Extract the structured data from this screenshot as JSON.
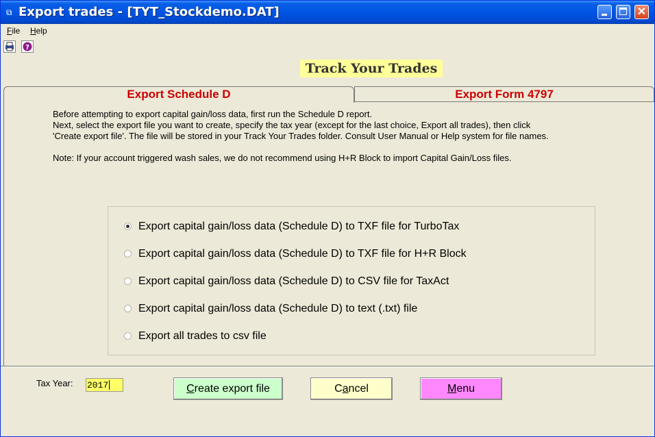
{
  "window": {
    "title": "Export trades - [TYT_Stockdemo.DAT]",
    "controls": {
      "minimize": "",
      "maximize": "",
      "close": "✕"
    }
  },
  "menubar": {
    "items": [
      {
        "mnemonic": "F",
        "rest": "ile"
      },
      {
        "mnemonic": "H",
        "rest": "elp"
      }
    ]
  },
  "toolbar": {
    "icons": [
      "print-icon",
      "help-icon"
    ]
  },
  "brand": {
    "text": "Track Your Trades"
  },
  "tabs": [
    {
      "label": "Export Schedule D",
      "active": true
    },
    {
      "label": "Export Form 4797",
      "active": false
    }
  ],
  "instructions": {
    "line1": "Before attempting to export capital gain/loss data, first run the Schedule D report.",
    "line2": "Next, select the export file you want to create, specify the tax year (except for the last choice, Export all trades), then click",
    "line3": "'Create export file'.  The file will be stored in your Track Your Trades folder.  Consult User Manual or Help system for file names.",
    "note": "Note: If your account triggered wash sales, we do not recommend using H+R Block to import Capital Gain/Loss files."
  },
  "options": [
    {
      "label": "Export capital gain/loss data (Schedule D) to TXF file for TurboTax",
      "selected": true
    },
    {
      "label": "Export capital gain/loss data (Schedule D) to TXF file for H+R Block",
      "selected": false
    },
    {
      "label": "Export capital gain/loss data (Schedule D) to CSV file for TaxAct",
      "selected": false
    },
    {
      "label": "Export capital gain/loss data (Schedule D) to text (.txt) file",
      "selected": false
    },
    {
      "label": "Export all trades to csv file",
      "selected": false
    }
  ],
  "tax_year": {
    "label": "Tax Year:",
    "value": "2017"
  },
  "buttons": {
    "create": {
      "mnemonic": "C",
      "rest": "reate export file",
      "color": "#ccffcc"
    },
    "cancel": {
      "pre": "C",
      "mnemonic": "a",
      "rest": "ncel",
      "color": "#ffffcc"
    },
    "menu": {
      "mnemonic": "M",
      "rest": "enu",
      "color": "#ff88ff"
    }
  },
  "colors": {
    "titlebar": "#0054e3",
    "tab_text": "#cc0000",
    "brand_bg": "#ffff99",
    "tax_input_bg": "#ffff66"
  }
}
